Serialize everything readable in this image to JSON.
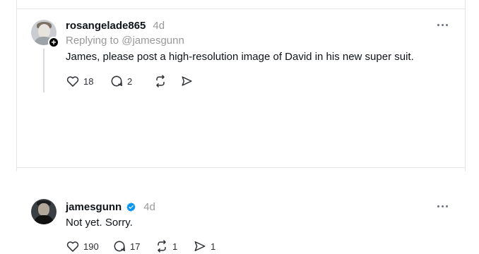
{
  "posts": [
    {
      "username": "rosangelade865",
      "time": "4d",
      "replying_prefix": "Replying to ",
      "replying_to": "@jamesgunn",
      "text": "James, please post a high-resolution image of David in his new super suit.",
      "likes": "18",
      "replies": "2",
      "reposts": "",
      "shares": ""
    },
    {
      "username": "jamesgunn",
      "time": "4d",
      "verified": true,
      "text": "Not yet. Sorry.",
      "likes": "190",
      "replies": "17",
      "reposts": "1",
      "shares": "1"
    }
  ],
  "colors": {
    "text": "#0f1419",
    "muted": "#999999",
    "verified": "#0095f6",
    "thread_line": "#d7dbdf",
    "border": "#e6e6e6"
  },
  "icons": {
    "like": "heart-icon",
    "reply": "comment-icon",
    "repost": "repost-icon",
    "share": "send-icon",
    "more": "more-icon",
    "follow": "plus-icon",
    "verified": "verified-badge-icon"
  }
}
